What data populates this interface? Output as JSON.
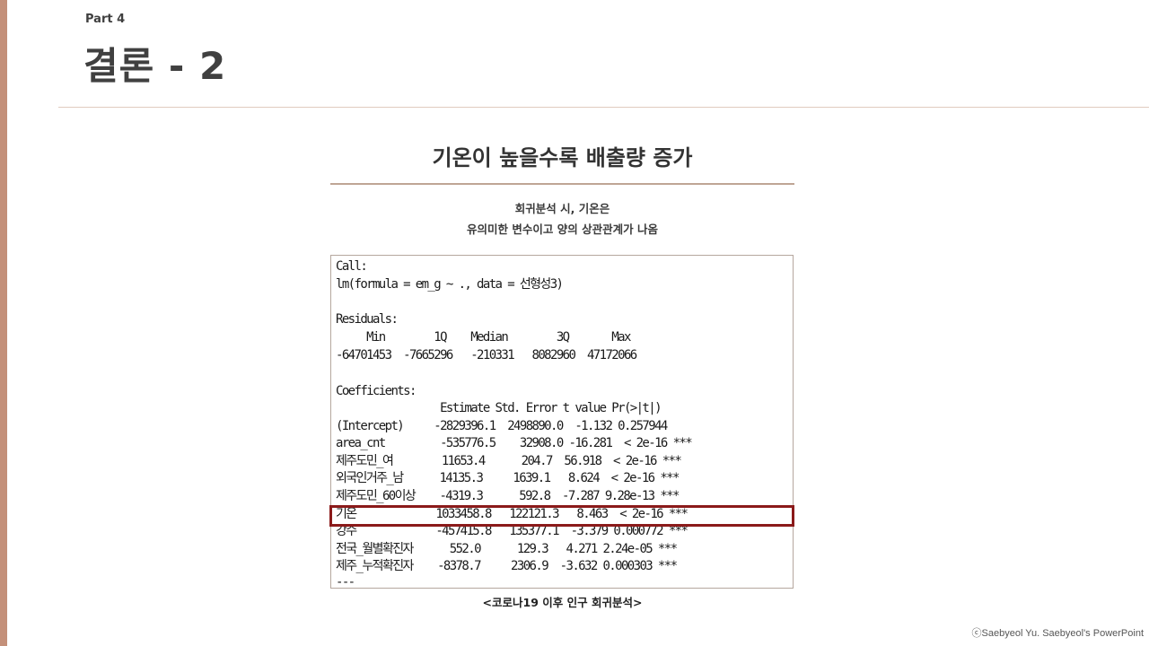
{
  "slide": {
    "part_label": "Part 4",
    "title": "결론 - 2",
    "heading": "기온이 높을수록 배출량 증가",
    "subtitle_line1": "회귀분석 시, 기온은",
    "subtitle_line2": "유의미한 변수이고 양의 상관관계가 나옴",
    "caption": "<코로나19 이후 인구 회귀분석>",
    "copyright": "ⓒSaebyeol Yu. Saebyeol's PowerPoint"
  },
  "regression_output": {
    "lines": [
      "Call:",
      "lm(formula = em_g ~ ., data = 선형성3)",
      "",
      "Residuals:",
      "     Min        1Q    Median        3Q       Max ",
      "-64701453  -7665296   -210331   8082960  47172066 ",
      "",
      "Coefficients:",
      "                 Estimate Std. Error t value Pr(>|t|)    ",
      "(Intercept)     -2829396.1  2498890.0  -1.132 0.257944    ",
      "area_cnt         -535776.5    32908.0 -16.281  < 2e-16 ***",
      "제주도민_여        11653.4      204.7  56.918  < 2e-16 ***",
      "외국인거주_남      14135.3     1639.1   8.624  < 2e-16 ***",
      "제주도민_60이상    -4319.3      592.8  -7.287 9.28e-13 ***",
      "기온             1033458.8   122121.3   8.463  < 2e-16 ***",
      "강수             -457415.8   135377.1  -3.379 0.000772 ***",
      "전국_월별확진자      552.0      129.3   4.271 2.24e-05 ***",
      "제주_누적확진자    -8378.7     2306.9  -3.632 0.000303 ***",
      "---"
    ]
  },
  "colors": {
    "accent": "#c4907a",
    "divider": "#e0cbbf",
    "heading_rule": "#bfa595",
    "highlight": "#8b1a1a"
  }
}
